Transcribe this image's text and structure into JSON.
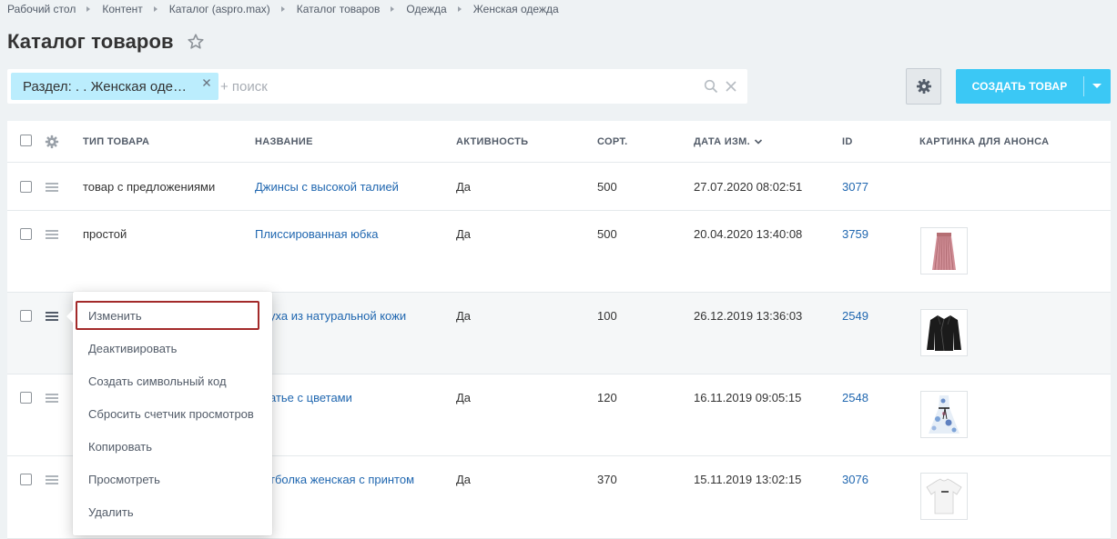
{
  "breadcrumbs": [
    "Рабочий стол",
    "Контент",
    "Каталог (aspro.max)",
    "Каталог товаров",
    "Одежда",
    "Женская одежда"
  ],
  "page": {
    "title": "Каталог товаров"
  },
  "filter": {
    "chip_label": "Раздел: . . Женская оде…",
    "search_placeholder": "+ поиск",
    "search_value": ""
  },
  "toolbar": {
    "create_label": "СОЗДАТЬ ТОВАР"
  },
  "grid": {
    "columns": {
      "type": "ТИП ТОВАРА",
      "name": "НАЗВАНИЕ",
      "active": "АКТИВНОСТЬ",
      "sort": "СОРТ.",
      "date": "ДАТА ИЗМ.",
      "id": "ID",
      "picture": "КАРТИНКА ДЛЯ АНОНСА"
    },
    "sorted_column": "date",
    "rows": [
      {
        "type": "товар с предложениями",
        "name": "Джинсы с высокой талией",
        "active": "Да",
        "sort": "500",
        "date": "27.07.2020 08:02:51",
        "id": "3077",
        "picture": ""
      },
      {
        "type": "простой",
        "name": "Плиссированная юбка",
        "active": "Да",
        "sort": "500",
        "date": "20.04.2020 13:40:08",
        "id": "3759",
        "picture": "pleated-skirt"
      },
      {
        "type": "",
        "name": "уха из натуральной кожи",
        "active": "Да",
        "sort": "100",
        "date": "26.12.2019 13:36:03",
        "id": "2549",
        "picture": "leather-jacket"
      },
      {
        "type": "",
        "name": "атье с цветами",
        "active": "Да",
        "sort": "120",
        "date": "16.11.2019 09:05:15",
        "id": "2548",
        "picture": "floral-dress"
      },
      {
        "type": "",
        "name": "тболка женская с принтом",
        "active": "Да",
        "sort": "370",
        "date": "15.11.2019 13:02:15",
        "id": "3076",
        "picture": "white-tshirt"
      }
    ]
  },
  "context_menu": {
    "items": [
      "Изменить",
      "Деактивировать",
      "Создать символьный код",
      "Сбросить счетчик просмотров",
      "Копировать",
      "Просмотреть",
      "Удалить"
    ],
    "focused_index": 0
  },
  "colors": {
    "background": "#eef2f4",
    "accent": "#3bc8f5",
    "chip": "#bbedfd",
    "link": "#2067b0",
    "focus_border": "#a32a2a"
  }
}
